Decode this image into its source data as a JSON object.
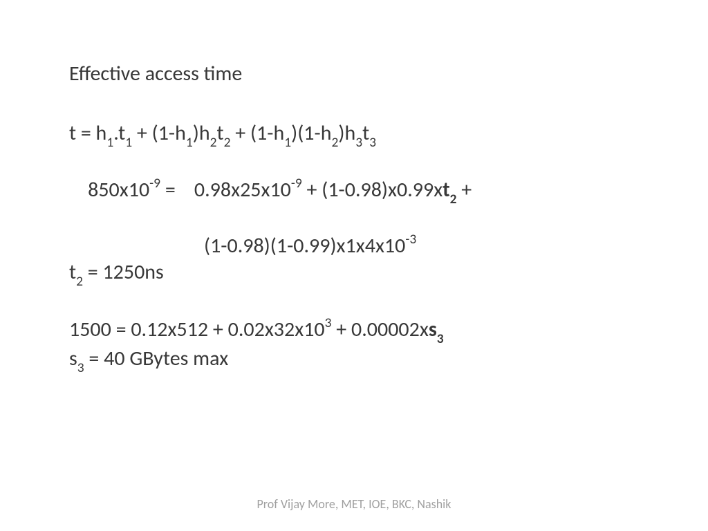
{
  "title": "Effective access time",
  "eq1": {
    "pre": "t = h",
    "s1": "1",
    "mid1": ".t",
    "s2": "1",
    "mid2": " + (1-h",
    "s3": "1",
    "mid3": ")h",
    "s4": "2",
    "mid4": "t",
    "s5": "2",
    "mid5": " + (1-h",
    "s6": "1",
    "mid6": ")(1-h",
    "s7": "2",
    "mid7": ")h",
    "s8": "3",
    "mid8": "t",
    "s9": "3"
  },
  "eq2": {
    "a": "850x10",
    "a_sup": "-9",
    "b": " =    0.98x25x10",
    "b_sup": "-9",
    "c": " + (1-0.98)x0.99x",
    "d": "t",
    "d_sub": "2",
    "e": " +"
  },
  "eq3": "(1-0.98)(1-0.99)x1x4x10",
  "eq3_sup": "-3",
  "eq4": {
    "a": "t",
    "a_sub": "2",
    "b": " = 1250ns"
  },
  "eq5": {
    "a": "1500 = 0.12x512 + 0.02x32x10",
    "a_sup": "3",
    "b": " + 0.00002x",
    "c": "s",
    "c_sub": "3"
  },
  "eq6": {
    "a": "s",
    "a_sub": "3",
    "b": " = 40 GBytes max"
  },
  "footer": "Prof Vijay More, MET, IOE, BKC, Nashik"
}
